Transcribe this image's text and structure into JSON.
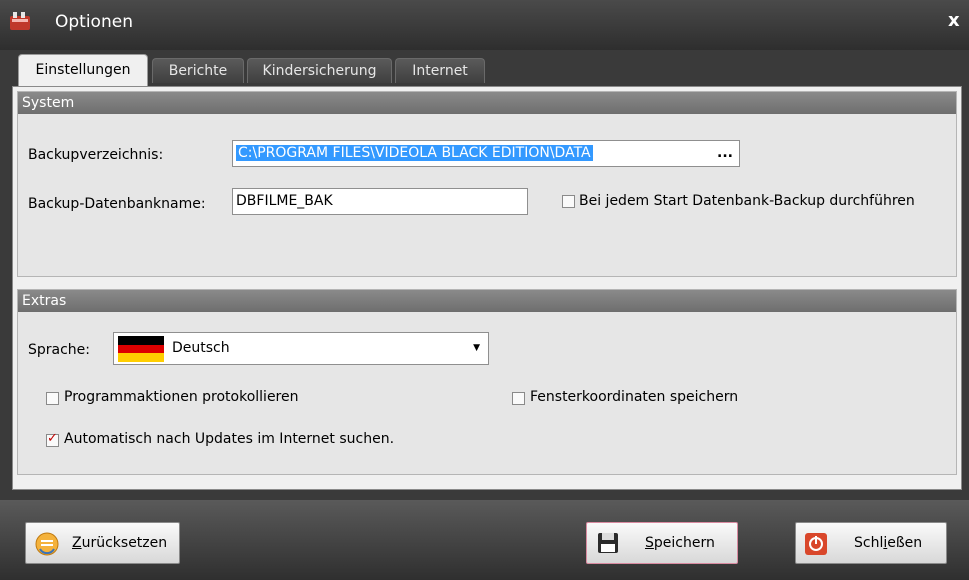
{
  "window": {
    "title": "Optionen",
    "close_symbol": "x"
  },
  "tabs": [
    {
      "label": "Einstellungen",
      "active": true
    },
    {
      "label": "Berichte",
      "active": false
    },
    {
      "label": "Kindersicherung",
      "active": false
    },
    {
      "label": "Internet",
      "active": false
    }
  ],
  "system": {
    "header": "System",
    "backup_dir_label": "Backupverzeichnis:",
    "backup_dir_value": "C:\\PROGRAM FILES\\VIDEOLA BLACK EDITION\\DATA",
    "browse_label": "...",
    "db_name_label": "Backup-Datenbankname:",
    "db_name_value": "DBFILME_BAK",
    "backup_on_start_label": "Bei jedem Start Datenbank-Backup durchführen",
    "backup_on_start_checked": false
  },
  "extras": {
    "header": "Extras",
    "language_label": "Sprache:",
    "language_value": "Deutsch",
    "flag_colors": [
      "#000000",
      "#dd0000",
      "#ffce00"
    ],
    "log_actions_label": "Programmaktionen protokollieren",
    "log_actions_checked": false,
    "save_coords_label": "Fensterkoordinaten  speichern",
    "save_coords_checked": false,
    "auto_update_label": "Automatisch nach Updates im Internet suchen.",
    "auto_update_checked": true,
    "check_mark": "✓"
  },
  "footer": {
    "reset": {
      "hotkey": "Z",
      "rest": "urücksetzen",
      "icon": "reset-icon"
    },
    "save": {
      "hotkey": "S",
      "rest": "peichern",
      "icon": "floppy-disk-icon"
    },
    "close": {
      "prefix": "Schl",
      "hotkey": "i",
      "rest": "eßen",
      "icon": "power-icon"
    }
  },
  "colors": {
    "accent_selection": "#3399ff",
    "check_red": "#c00000",
    "close_icon": "#d9472b"
  }
}
